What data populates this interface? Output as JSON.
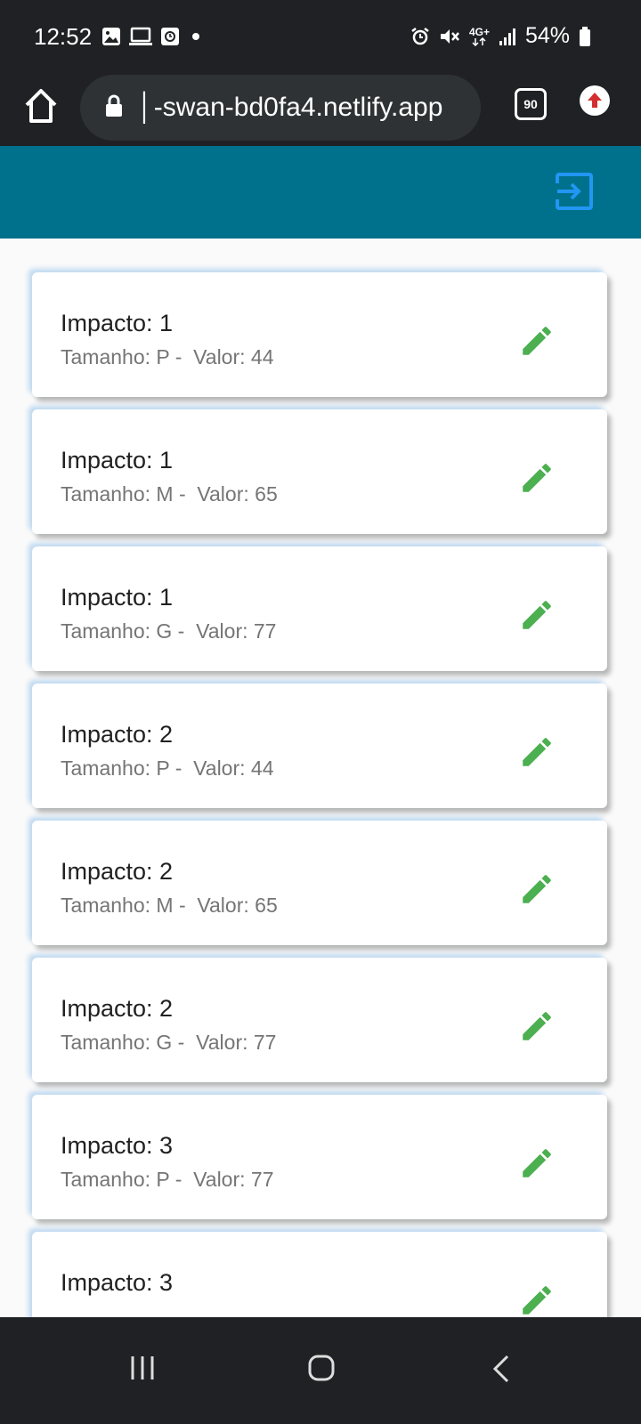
{
  "status_bar": {
    "time": "12:52",
    "network": "4G+",
    "battery": "54%"
  },
  "browser": {
    "url": "│-swan-bd0fa4.netlify.app",
    "tab_count": "90"
  },
  "colors": {
    "app_bar": "#00718d",
    "edit_icon": "#4caf50",
    "logout_icon": "#2196f3"
  },
  "cards": [
    {
      "title": "Impacto: 1",
      "subtitle": "Tamanho: P -  Valor: 44"
    },
    {
      "title": "Impacto: 1",
      "subtitle": "Tamanho: M -  Valor: 65"
    },
    {
      "title": "Impacto: 1",
      "subtitle": "Tamanho: G -  Valor: 77"
    },
    {
      "title": "Impacto: 2",
      "subtitle": "Tamanho: P -  Valor: 44"
    },
    {
      "title": "Impacto: 2",
      "subtitle": "Tamanho: M -  Valor: 65"
    },
    {
      "title": "Impacto: 2",
      "subtitle": "Tamanho: G -  Valor: 77"
    },
    {
      "title": "Impacto: 3",
      "subtitle": "Tamanho: P -  Valor: 77"
    },
    {
      "title": "Impacto: 3",
      "subtitle": ""
    }
  ]
}
